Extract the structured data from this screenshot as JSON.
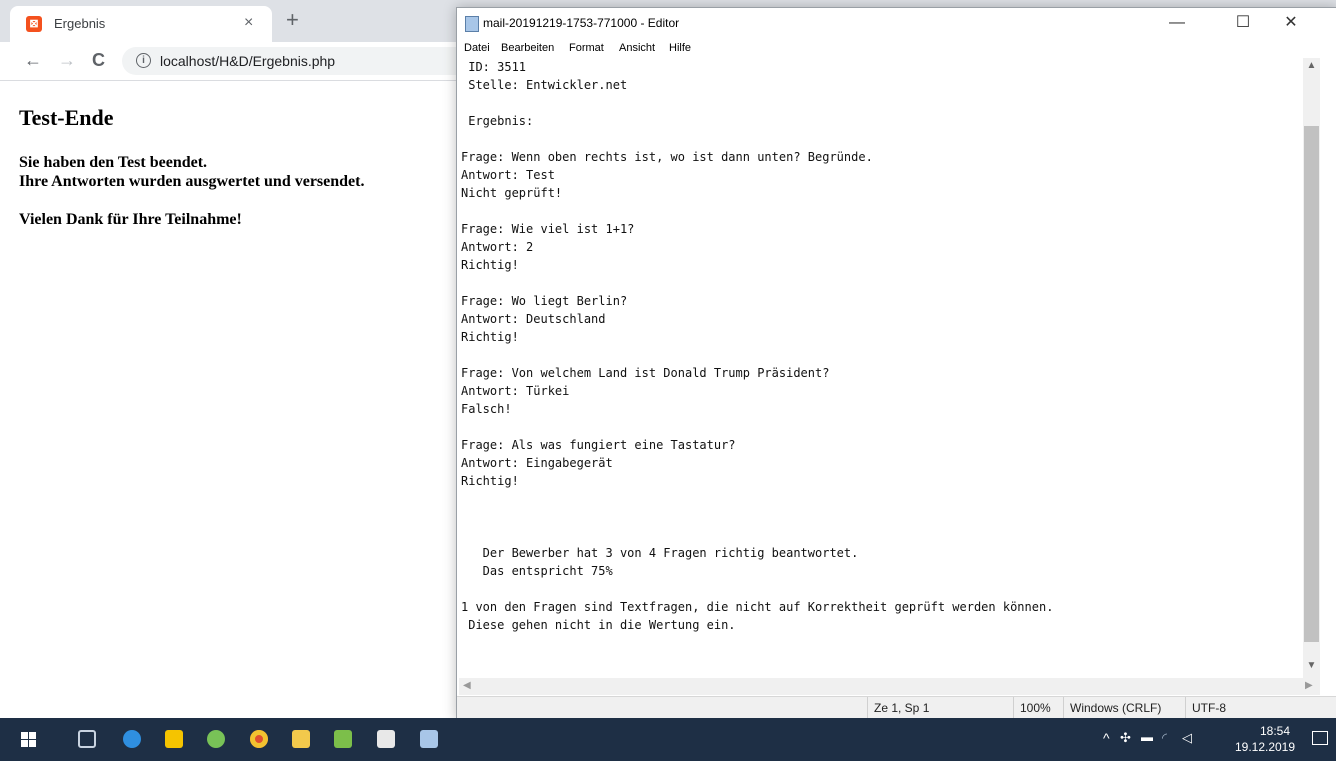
{
  "browser": {
    "tab_title": "Ergebnis",
    "tab_close": "×",
    "new_tab": "+",
    "back": "←",
    "forward": "→",
    "reload": "C",
    "info": "i",
    "url": "localhost/H&D/Ergebnis.php",
    "menu": "⋮",
    "page": {
      "heading": "Test-Ende",
      "line1": "Sie haben den Test beendet.",
      "line2": "Ihre Antworten wurden ausgwertet und versendet.",
      "line3": "Vielen Dank für Ihre Teilnahme!"
    }
  },
  "notepad": {
    "title": "mail-20191219-1753-771000 - Editor",
    "minimize": "—",
    "maximize": "☐",
    "close": "✕",
    "menus": [
      "Datei",
      "Bearbeiten",
      "Format",
      "Ansicht",
      "Hilfe"
    ],
    "content": " ID: 3511\n Stelle: Entwickler.net\n\n Ergebnis:\n\nFrage: Wenn oben rechts ist, wo ist dann unten? Begründe.\nAntwort: Test\nNicht geprüft!\n\nFrage: Wie viel ist 1+1?\nAntwort: 2\nRichtig!\n\nFrage: Wo liegt Berlin?\nAntwort: Deutschland\nRichtig!\n\nFrage: Von welchem Land ist Donald Trump Präsident?\nAntwort: Türkei\nFalsch!\n\nFrage: Als was fungiert eine Tastatur?\nAntwort: Eingabegerät\nRichtig!\n\n\n\n   Der Bewerber hat 3 von 4 Fragen richtig beantwortet.\n   Das entspricht 75%\n\n1 von den Fragen sind Textfragen, die nicht auf Korrektheit geprüft werden können.\n Diese gehen nicht in die Wertung ein.",
    "status": {
      "position": "Ze 1, Sp 1",
      "zoom": "100%",
      "line_ending": "Windows (CRLF)",
      "encoding": "UTF-8"
    }
  },
  "taskbar": {
    "time": "18:54",
    "date": "19.12.2019",
    "tray_chevron": "^"
  }
}
